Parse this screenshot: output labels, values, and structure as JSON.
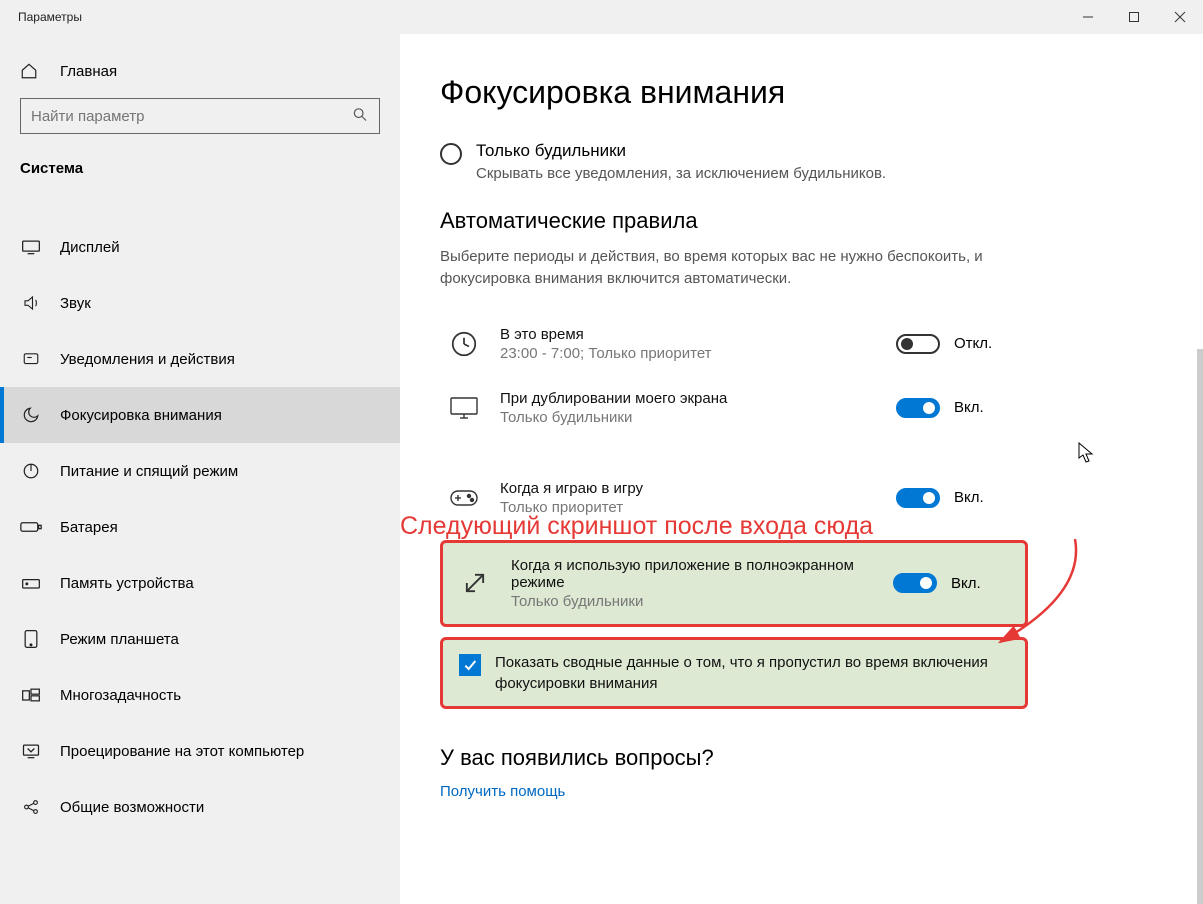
{
  "window": {
    "title": "Параметры"
  },
  "sidebar": {
    "home": "Главная",
    "search_placeholder": "Найти параметр",
    "section": "Система",
    "items": [
      {
        "label": "Дисплей"
      },
      {
        "label": "Звук"
      },
      {
        "label": "Уведомления и действия"
      },
      {
        "label": "Фокусировка внимания"
      },
      {
        "label": "Питание и спящий режим"
      },
      {
        "label": "Батарея"
      },
      {
        "label": "Память устройства"
      },
      {
        "label": "Режим планшета"
      },
      {
        "label": "Многозадачность"
      },
      {
        "label": "Проецирование на этот компьютер"
      },
      {
        "label": "Общие возможности"
      }
    ]
  },
  "main": {
    "title": "Фокусировка внимания",
    "radio": {
      "label": "Только будильники",
      "desc": "Скрывать все уведомления, за исключением будильников."
    },
    "auto": {
      "heading": "Автоматические правила",
      "desc": "Выберите периоды и действия, во время которых вас не нужно беспокоить, и фокусировка внимания включится автоматически.",
      "rules": [
        {
          "title": "В это время",
          "sub": "23:00 - 7:00; Только приоритет",
          "on": false,
          "state": "Откл."
        },
        {
          "title": "При дублировании моего экрана",
          "sub": "Только будильники",
          "on": true,
          "state": "Вкл."
        },
        {
          "title": "Когда я играю в игру",
          "sub": "Только приоритет",
          "on": true,
          "state": "Вкл."
        },
        {
          "title": "Когда я использую приложение в полноэкранном режиме",
          "sub": "Только будильники",
          "on": true,
          "state": "Вкл."
        }
      ],
      "checkbox_text": "Показать сводные данные о том, что я пропустил во время включения фокусировки внимания"
    },
    "annotation": "Следующий скриншот после входа сюда",
    "questions": "У вас появились вопросы?",
    "help_link": "Получить помощь"
  }
}
